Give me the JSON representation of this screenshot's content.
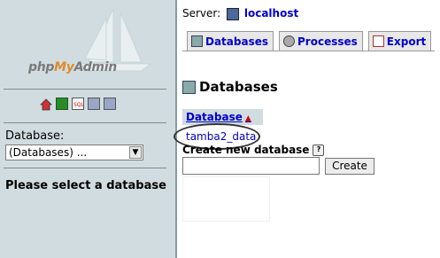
{
  "nav": {
    "logo": "phpMyAdmin",
    "database_label": "Database:",
    "database_select": "(Databases) ...",
    "select_message": "Please select a database",
    "icons": [
      "home-icon",
      "exit-icon",
      "sql-icon",
      "help-icon",
      "docs-icon"
    ]
  },
  "main": {
    "server_label": "Server:",
    "server_name": "localhost",
    "tabs": [
      {
        "label": "Databases",
        "icon": "database-icon"
      },
      {
        "label": "Processes",
        "icon": "processes-icon"
      },
      {
        "label": "Export",
        "icon": "export-icon"
      }
    ],
    "heading": "Databases",
    "column_header": "Database",
    "databases": [
      "tamba2_data"
    ],
    "create_label": "Create new database",
    "new_db_value": "",
    "create_button": "Create"
  }
}
